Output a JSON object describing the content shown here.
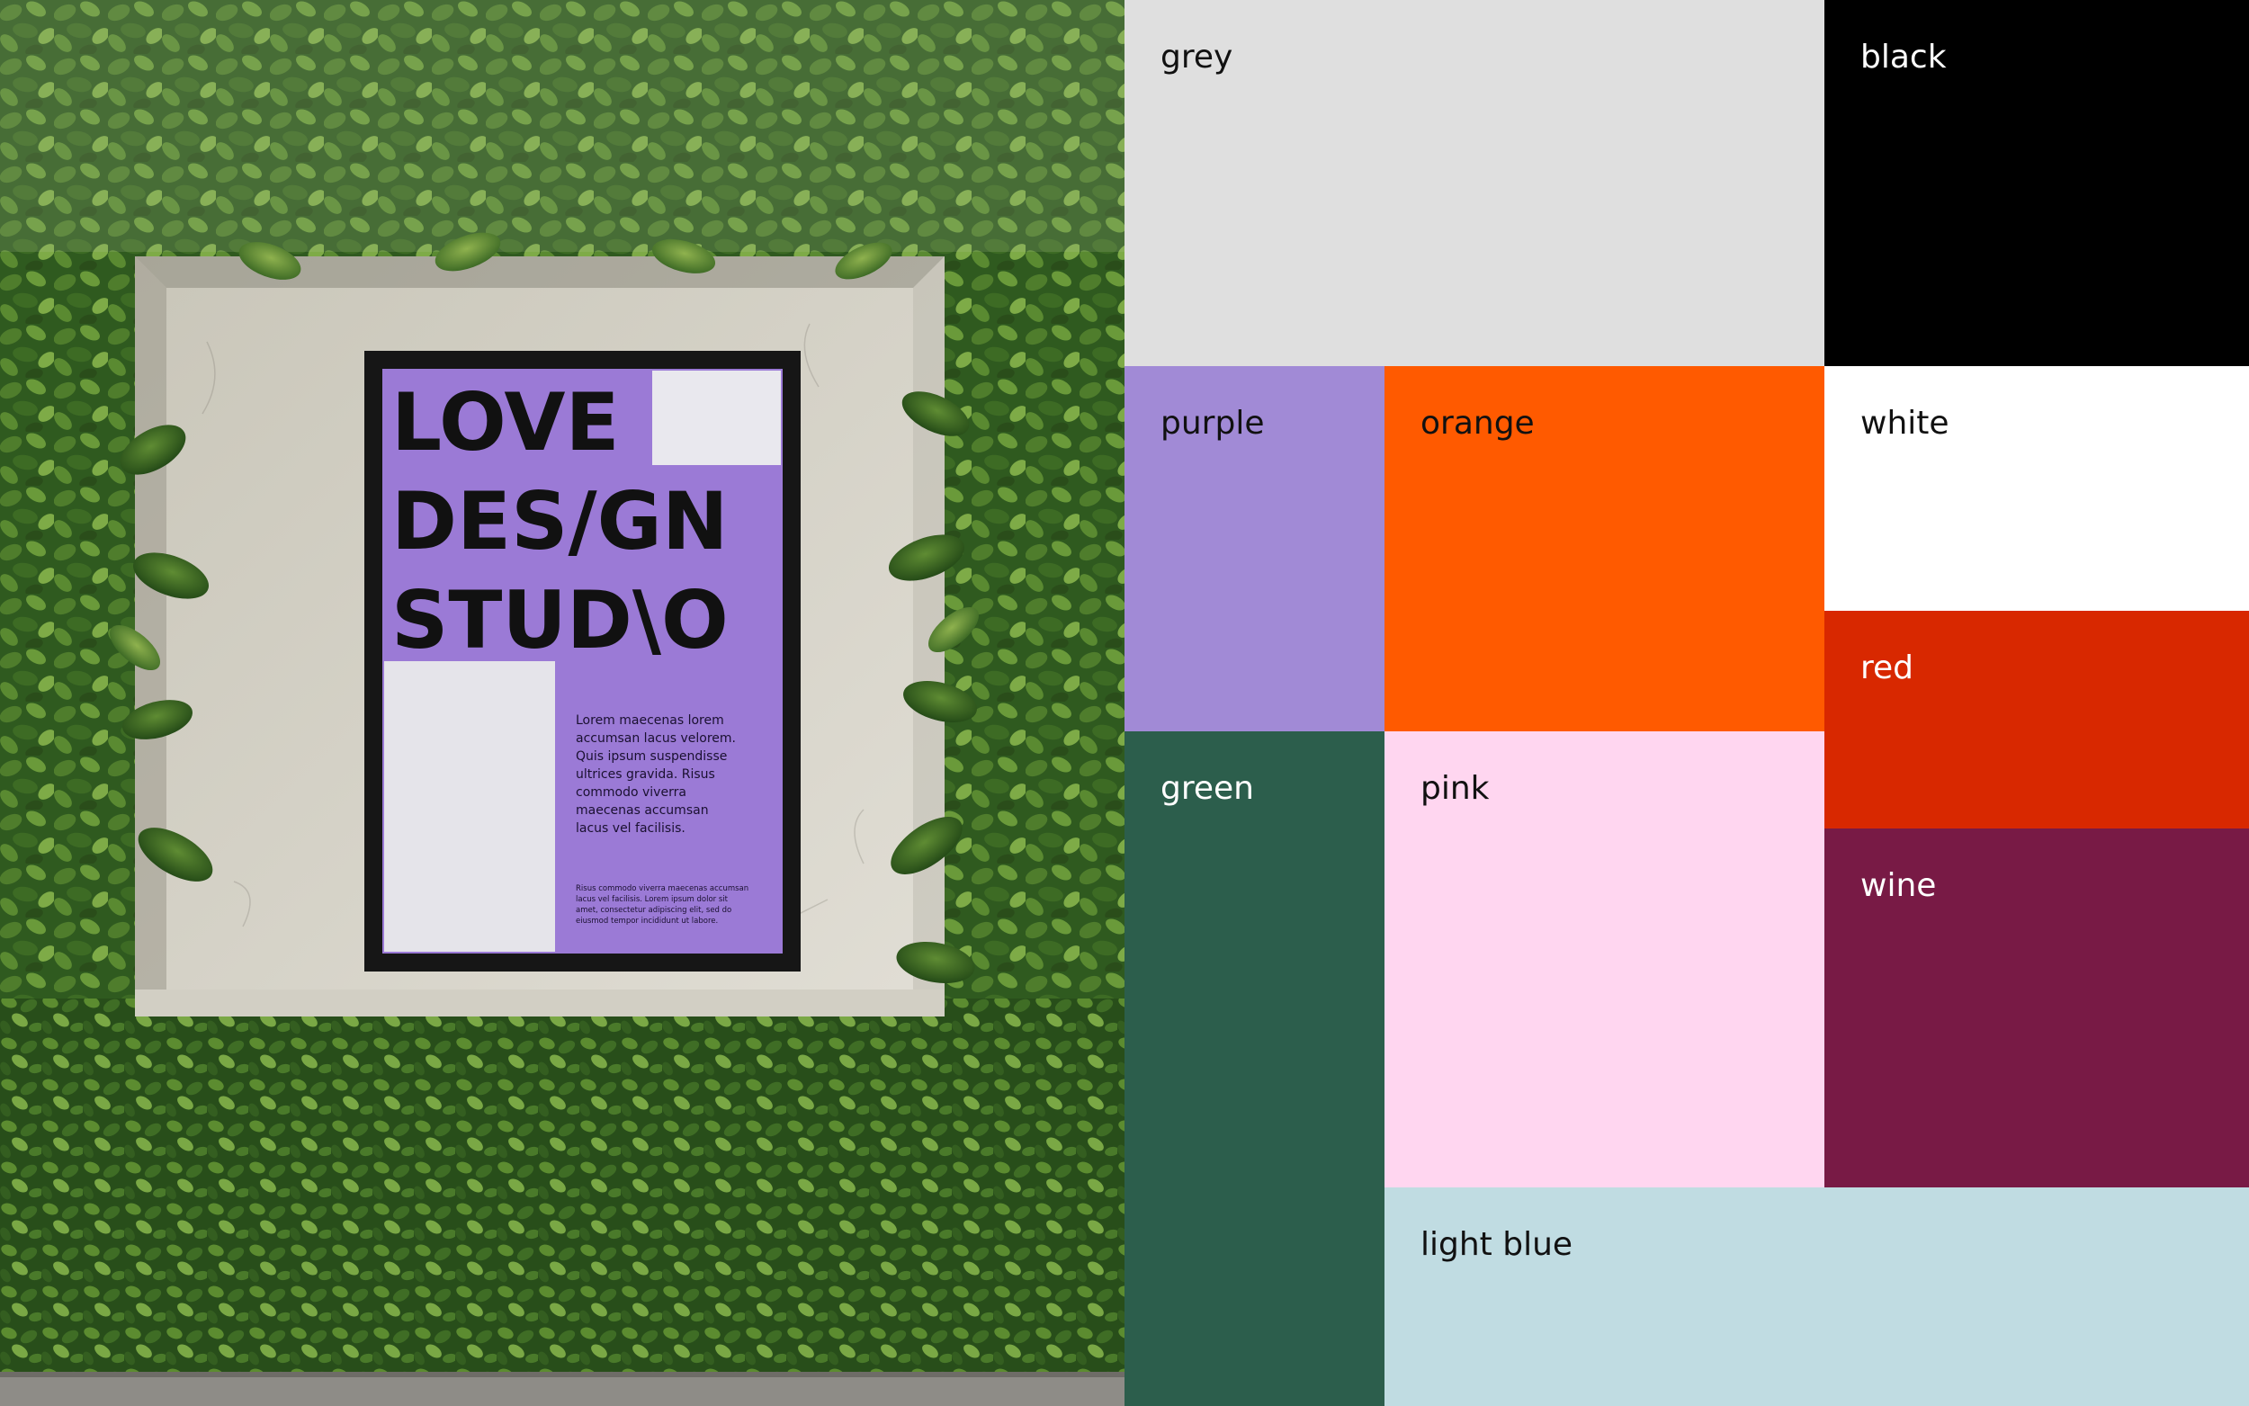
{
  "photo": {
    "poster": {
      "headline_lines": [
        "LOVE",
        "DES/GN",
        "STUD\\O"
      ],
      "body_lines": [
        "Lorem maecenas lorem",
        "accumsan lacus velorem.",
        "Quis ipsum suspendisse",
        "ultrices gravida. Risus",
        "commodo viverra",
        "maecenas accumsan",
        "lacus vel facilisis."
      ],
      "footer_lines": [
        "Risus commodo viverra maecenas accumsan",
        "lacus vel facilisis. Lorem ipsum dolor sit",
        "amet, consectetur adipiscing elit, sed do",
        "eiusmod tempor incididunt ut labore."
      ],
      "background_color": "#9b7ad6"
    }
  },
  "swatches": {
    "grey": {
      "label": "grey",
      "color": "#dfdfdf",
      "text_color": "#111111"
    },
    "black": {
      "label": "black",
      "color": "#000000",
      "text_color": "#ffffff"
    },
    "purple": {
      "label": "purple",
      "color": "#a18ad6",
      "text_color": "#111111"
    },
    "orange": {
      "label": "orange",
      "color": "#ff5a00",
      "text_color": "#111111"
    },
    "white": {
      "label": "white",
      "color": "#ffffff",
      "text_color": "#111111"
    },
    "red": {
      "label": "red",
      "color": "#d82800",
      "text_color": "#ffffff"
    },
    "green": {
      "label": "green",
      "color": "#2c5e4c",
      "text_color": "#ffffff"
    },
    "pink": {
      "label": "pink",
      "color": "#ffd6f0",
      "text_color": "#111111"
    },
    "wine": {
      "label": "wine",
      "color": "#781a45",
      "text_color": "#ffffff"
    },
    "light_blue": {
      "label": "light blue",
      "color": "#c0dce2",
      "text_color": "#111111"
    }
  }
}
